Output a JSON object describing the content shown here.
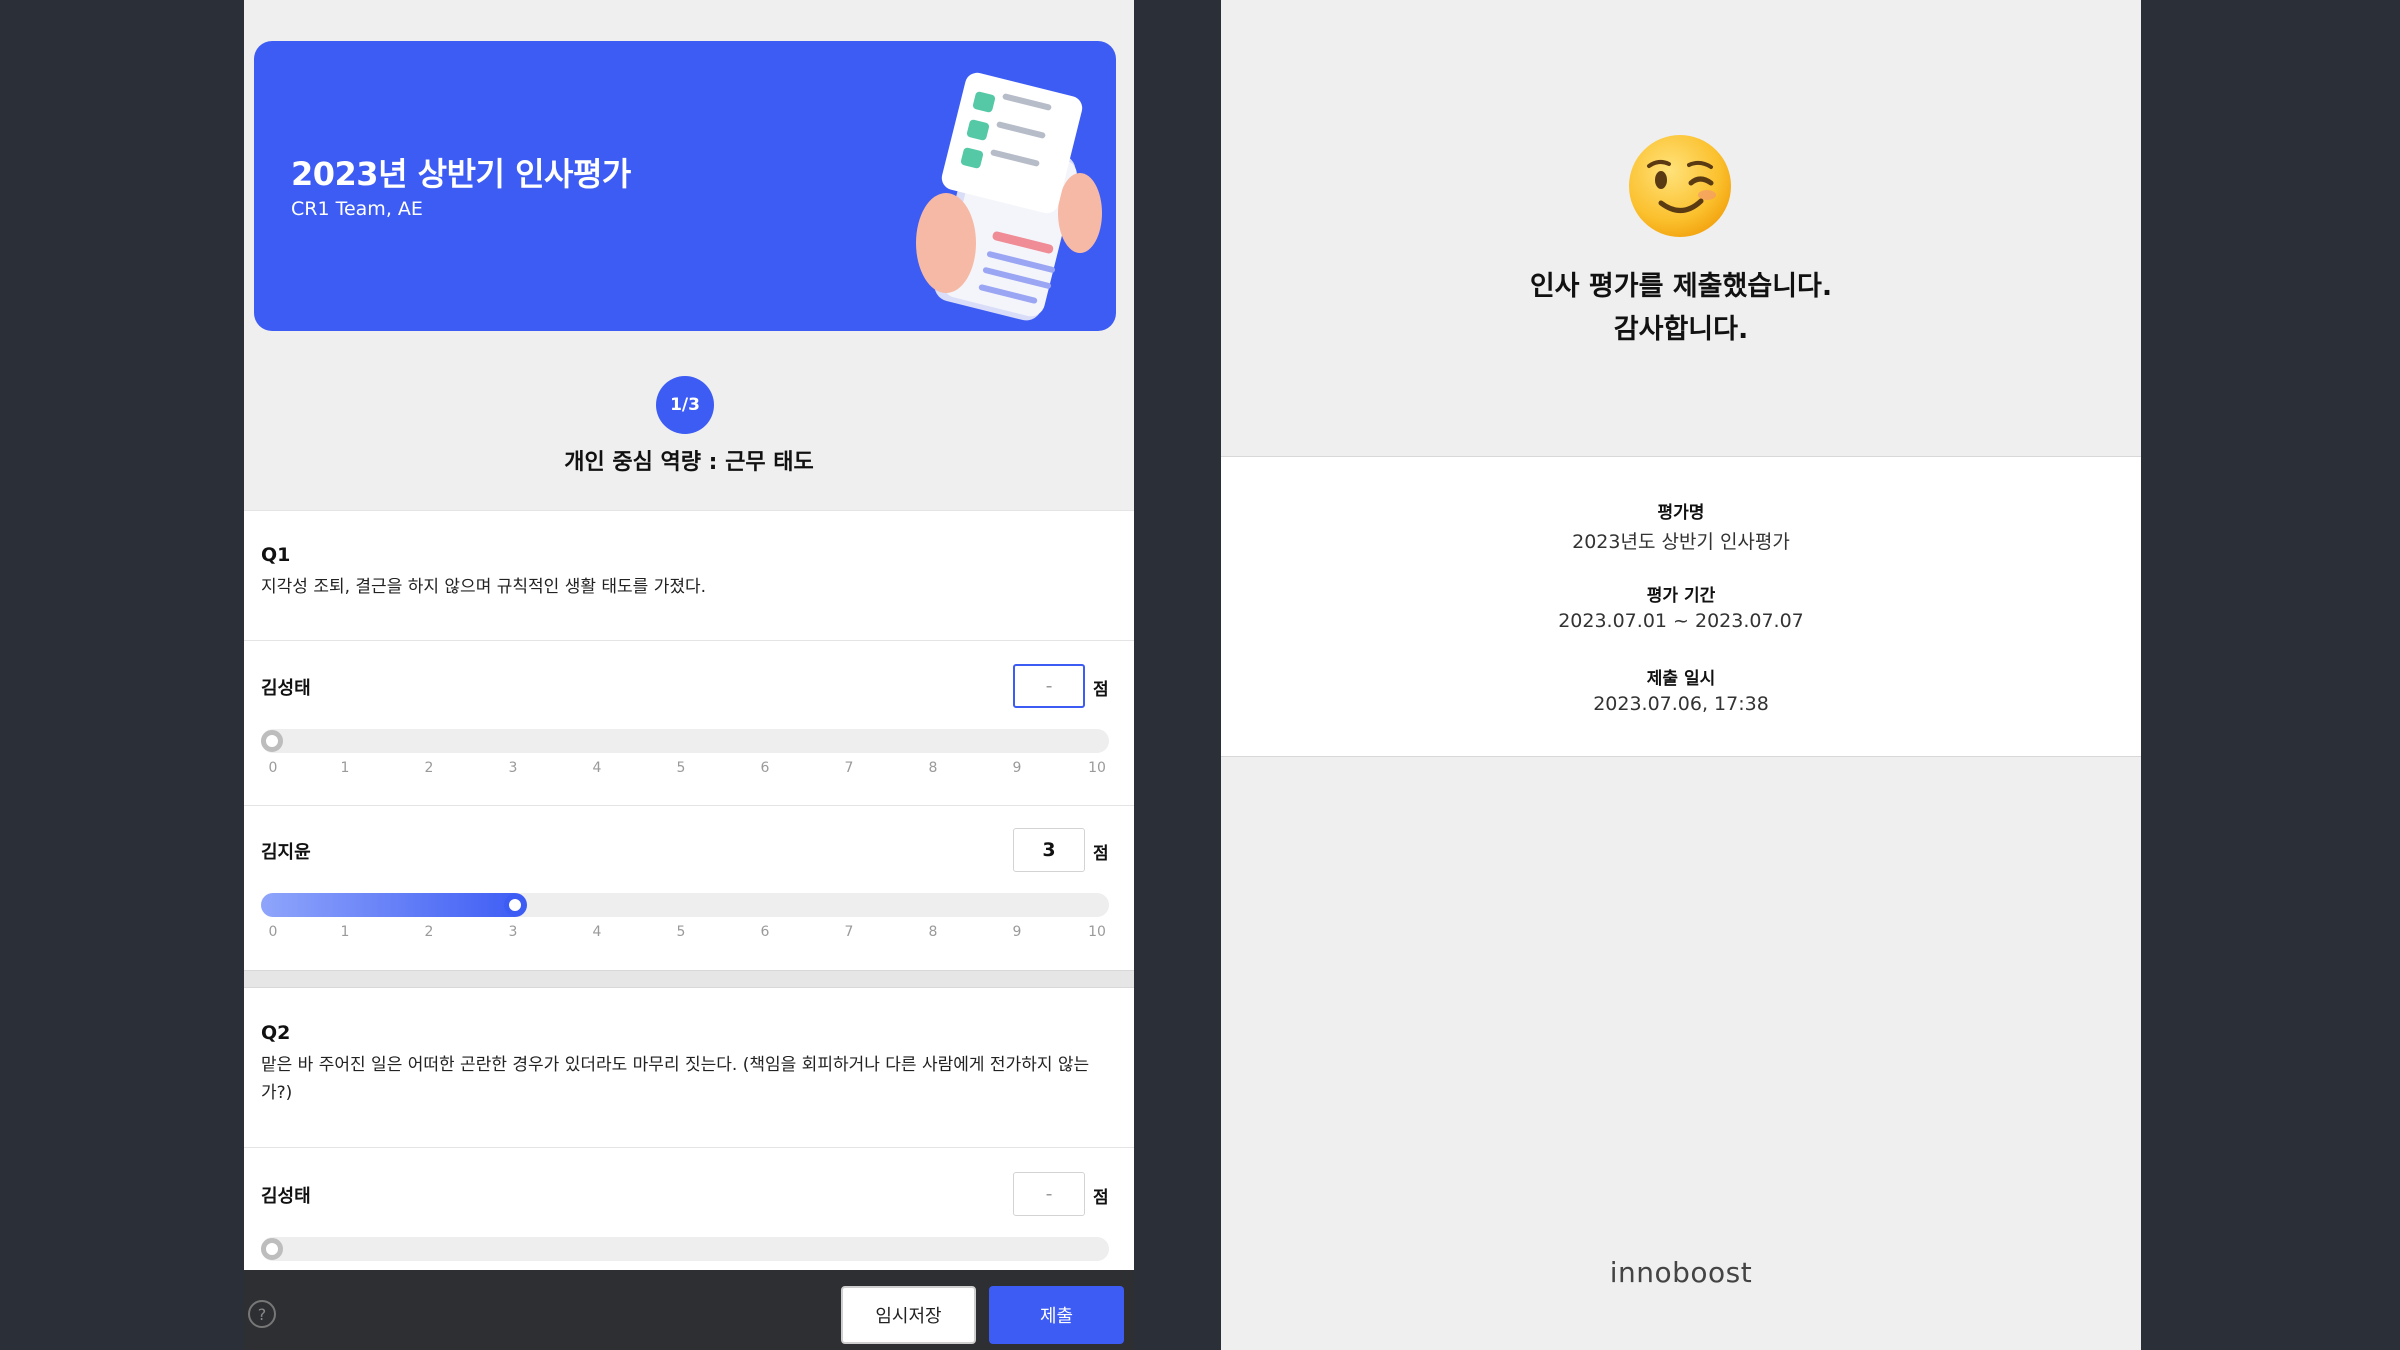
{
  "evaluation": {
    "banner_title": "2023년 상반기 인사평가",
    "banner_subtitle": "CR1 Team, AE",
    "step": "1/3",
    "section_title": "개인 중심 역량 : 근무 태도",
    "score_unit": "점",
    "scale_ticks": [
      "0",
      "1",
      "2",
      "3",
      "4",
      "5",
      "6",
      "7",
      "8",
      "9",
      "10"
    ],
    "questions": [
      {
        "label": "Q1",
        "text": "지각성 조퇴, 결근을 하지 않으며 규칙적인 생활 태도를 가졌다.",
        "ratings": [
          {
            "name": "김성태",
            "score": "-",
            "value": 0
          },
          {
            "name": "김지윤",
            "score": "3",
            "value": 3
          }
        ]
      },
      {
        "label": "Q2",
        "text": "맡은 바 주어진 일은 어떠한 곤란한 경우가 있더라도 마무리 짓는다. (책임을 회피하거나 다른 사람에게 전가하지 않는가?)",
        "ratings": [
          {
            "name": "김성태",
            "score": "-",
            "value": 0
          }
        ]
      }
    ]
  },
  "footer": {
    "help_icon": "?",
    "save_label": "임시저장",
    "submit_label": "제출"
  },
  "confirmation": {
    "emoji": "winking-face",
    "message_line1": "인사 평가를 제출했습니다.",
    "message_line2": "감사합니다.",
    "eval_name_label": "평가명",
    "eval_name": "2023년도 상반기 인사평가",
    "period_label": "평가 기간",
    "period": "2023.07.01 ~ 2023.07.07",
    "submitted_label": "제출 일시",
    "submitted": "2023.07.06, 17:38",
    "brand": "innoboost"
  },
  "colors": {
    "accent": "#3d5cf4",
    "background_dark": "#2a2f38",
    "panel": "#efefef"
  }
}
